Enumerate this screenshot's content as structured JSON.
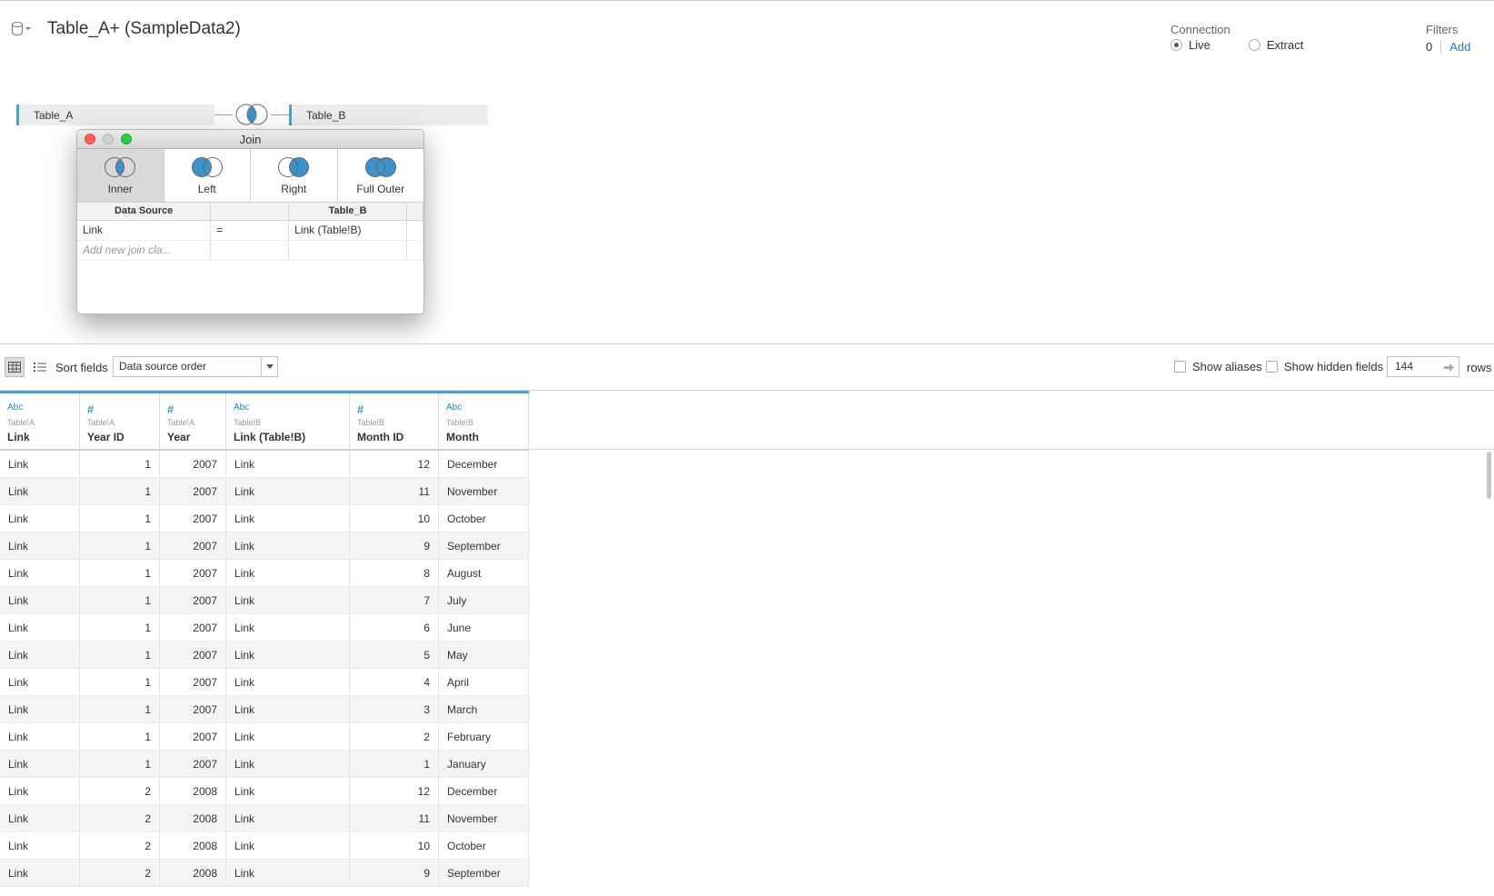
{
  "header": {
    "title": "Table_A+ (SampleData2)",
    "datasource_icon": "database-icon",
    "connection": {
      "label": "Connection",
      "options": [
        {
          "label": "Live",
          "selected": true
        },
        {
          "label": "Extract",
          "selected": false
        }
      ]
    },
    "filters": {
      "label": "Filters",
      "count": "0",
      "add_label": "Add"
    }
  },
  "canvas": {
    "left_table": "Table_A",
    "right_table": "Table_B",
    "join_icon": "inner-join-icon"
  },
  "join_dialog": {
    "title": "Join",
    "types": [
      {
        "label": "Inner",
        "icon": "inner-join-icon",
        "active": true
      },
      {
        "label": "Left",
        "icon": "left-join-icon",
        "active": false
      },
      {
        "label": "Right",
        "icon": "right-join-icon",
        "active": false
      },
      {
        "label": "Full Outer",
        "icon": "full-outer-join-icon",
        "active": false
      }
    ],
    "clause_headers": {
      "left": "Data Source",
      "op": "",
      "right": "Table_B"
    },
    "clauses": [
      {
        "left": "Link",
        "op": "=",
        "right": "Link (Table!B)"
      }
    ],
    "add_placeholder": "Add new join cla...",
    "accent": "#3e92cc"
  },
  "toolbar": {
    "sort_label": "Sort fields",
    "sort_value": "Data source order",
    "show_aliases": "Show aliases",
    "show_hidden": "Show hidden fields",
    "rows_value": "144",
    "rows_label": "rows"
  },
  "grid": {
    "columns": [
      {
        "type": "Abc",
        "source": "Table!A",
        "name": "Link"
      },
      {
        "type": "#",
        "source": "Table!A",
        "name": "Year ID"
      },
      {
        "type": "#",
        "source": "Table!A",
        "name": "Year"
      },
      {
        "type": "Abc",
        "source": "Table!B",
        "name": "Link (Table!B)"
      },
      {
        "type": "#",
        "source": "Table!B",
        "name": "Month ID"
      },
      {
        "type": "Abc",
        "source": "Table!B",
        "name": "Month"
      }
    ],
    "rows": [
      [
        "Link",
        "1",
        "2007",
        "Link",
        "12",
        "December"
      ],
      [
        "Link",
        "1",
        "2007",
        "Link",
        "11",
        "November"
      ],
      [
        "Link",
        "1",
        "2007",
        "Link",
        "10",
        "October"
      ],
      [
        "Link",
        "1",
        "2007",
        "Link",
        "9",
        "September"
      ],
      [
        "Link",
        "1",
        "2007",
        "Link",
        "8",
        "August"
      ],
      [
        "Link",
        "1",
        "2007",
        "Link",
        "7",
        "July"
      ],
      [
        "Link",
        "1",
        "2007",
        "Link",
        "6",
        "June"
      ],
      [
        "Link",
        "1",
        "2007",
        "Link",
        "5",
        "May"
      ],
      [
        "Link",
        "1",
        "2007",
        "Link",
        "4",
        "April"
      ],
      [
        "Link",
        "1",
        "2007",
        "Link",
        "3",
        "March"
      ],
      [
        "Link",
        "1",
        "2007",
        "Link",
        "2",
        "February"
      ],
      [
        "Link",
        "1",
        "2007",
        "Link",
        "1",
        "January"
      ],
      [
        "Link",
        "2",
        "2008",
        "Link",
        "12",
        "December"
      ],
      [
        "Link",
        "2",
        "2008",
        "Link",
        "11",
        "November"
      ],
      [
        "Link",
        "2",
        "2008",
        "Link",
        "10",
        "October"
      ],
      [
        "Link",
        "2",
        "2008",
        "Link",
        "9",
        "September"
      ]
    ]
  }
}
